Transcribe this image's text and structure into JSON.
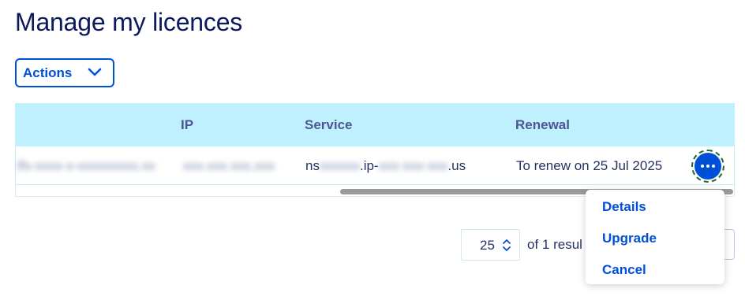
{
  "page": {
    "title": "Manage my licences"
  },
  "toolbar": {
    "actions_label": "Actions"
  },
  "table": {
    "columns": [
      "IP",
      "Service",
      "Renewal"
    ],
    "rows": [
      {
        "name": "lfs-xxxx-x-xxxxxxxxx.xx",
        "ip": "xxx.xxx.xxx.xxx",
        "service_prefix": "ns",
        "service_blur1": "xxxxxx",
        "service_mid": ".ip-",
        "service_blur2": "xxx-xxx-xxx",
        "service_suffix": ".us",
        "renewal": "To renew on 25 Jul 2025"
      }
    ]
  },
  "pagination": {
    "per_page": "25",
    "summary": "of 1 resul"
  },
  "row_menu": {
    "items": [
      "Details",
      "Upgrade",
      "Cancel"
    ]
  },
  "colors": {
    "accent": "#0050d7",
    "header_bg": "#bef1fd",
    "title": "#0a1a5c"
  }
}
